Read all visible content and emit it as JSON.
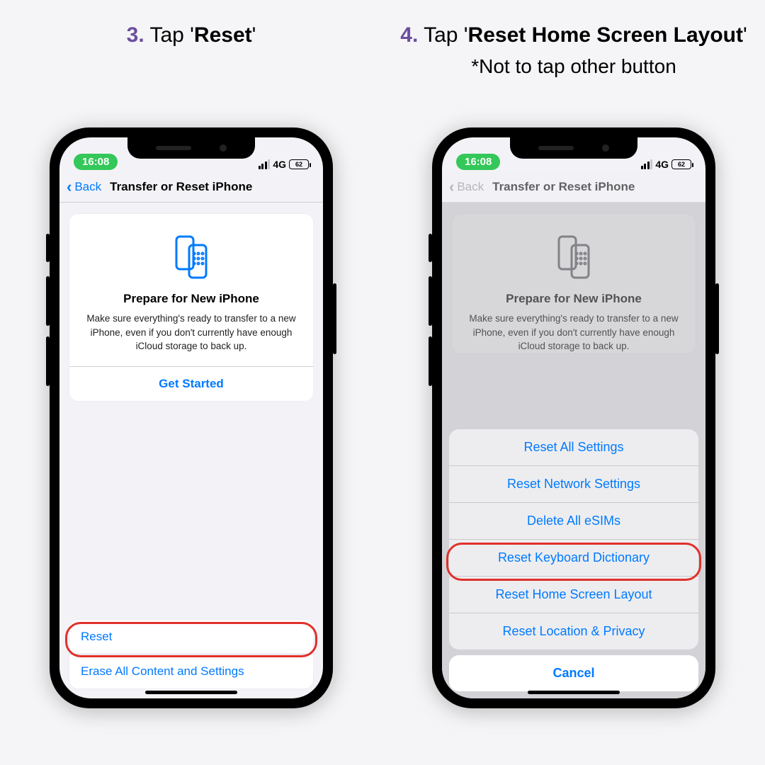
{
  "steps": {
    "left": {
      "num": "3.",
      "label_pre": "Tap '",
      "label_bold": "Reset",
      "label_post": "'"
    },
    "right": {
      "num": "4.",
      "label_pre": "Tap '",
      "label_bold": "Reset Home Screen Layout",
      "label_post": "'",
      "note": "*Not to tap other button"
    }
  },
  "status": {
    "time": "16:08",
    "net": "4G",
    "battery": "62"
  },
  "nav": {
    "back": "Back",
    "title": "Transfer or Reset iPhone"
  },
  "card": {
    "title": "Prepare for New iPhone",
    "body": "Make sure everything's ready to transfer to a new iPhone, even if you don't currently have enough iCloud storage to back up.",
    "cta": "Get Started"
  },
  "bottom": {
    "reset": "Reset",
    "erase": "Erase All Content and Settings"
  },
  "sheet": {
    "items": [
      "Reset All Settings",
      "Reset Network Settings",
      "Delete All eSIMs",
      "Reset Keyboard Dictionary",
      "Reset Home Screen Layout",
      "Reset Location & Privacy"
    ],
    "cancel": "Cancel"
  }
}
